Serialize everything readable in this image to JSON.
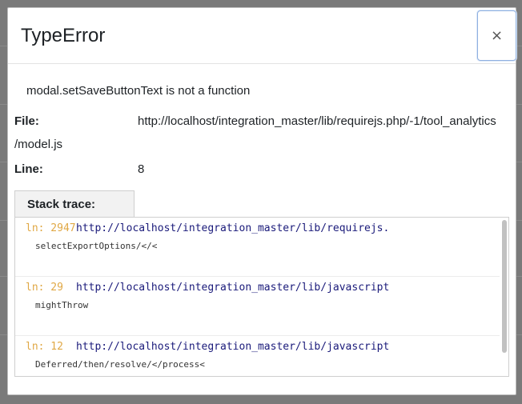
{
  "modal": {
    "title": "TypeError",
    "close_label": "×",
    "message": "modal.setSaveButtonText is not a function"
  },
  "info": {
    "file_label": "File:",
    "file_value_line1": "http://localhost/integration_master/lib/requirejs.php/-1/tool_analytics",
    "file_value_line2": "/model.js",
    "line_label": "Line:",
    "line_value": "8"
  },
  "stack": {
    "tab_label": "Stack trace:",
    "items": [
      {
        "ln": "ln: 2947",
        "url": "http://localhost/integration_master/lib/requirejs.",
        "fn": "selectExportOptions/</<"
      },
      {
        "ln": "ln: 29",
        "url": "http://localhost/integration_master/lib/javascript",
        "fn": "mightThrow"
      },
      {
        "ln": "ln: 12",
        "url": "http://localhost/integration_master/lib/javascript",
        "fn": "Deferred/then/resolve/</process<"
      }
    ]
  }
}
